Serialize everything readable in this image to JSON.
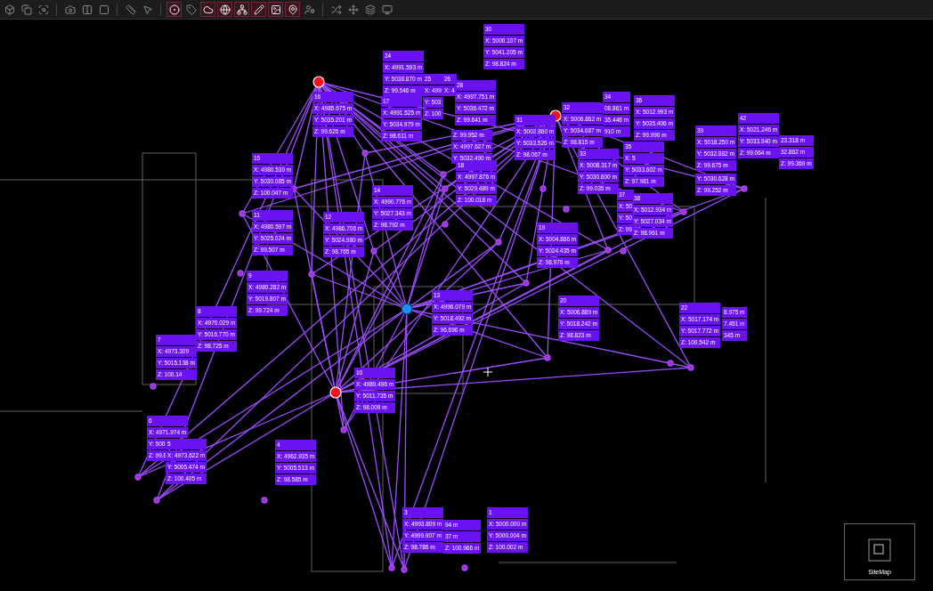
{
  "toolbar": {
    "groups": [
      [
        {
          "active": false
        },
        {
          "active": false
        },
        {
          "active": false
        }
      ],
      [
        {
          "active": false
        },
        {
          "active": false
        },
        {
          "active": false
        }
      ],
      [
        {
          "active": false
        },
        {
          "active": false
        }
      ],
      [
        {
          "active": true
        },
        {
          "active": false
        },
        {
          "active": true
        },
        {
          "active": true
        },
        {
          "active": true
        },
        {
          "active": true
        },
        {
          "active": true
        },
        {
          "active": true
        },
        {
          "active": false
        }
      ],
      [
        {
          "active": false
        },
        {
          "active": false
        },
        {
          "active": false
        },
        {
          "active": false
        }
      ]
    ]
  },
  "labels": [
    {
      "rows": [
        "30",
        "X: 5000.107 m",
        "Y: 5041.205 m",
        "Z: 98.824 m"
      ]
    },
    {
      "rows": [
        "24",
        "X: 4991.593 m",
        "Y: 5038.870 m",
        "Z: 99.546 m"
      ]
    },
    {
      "rows": [
        "25",
        "X: 499",
        "Y: 503",
        "Z: 100"
      ]
    },
    {
      "rows": [
        "26",
        "X: 4"
      ]
    },
    {
      "rows": [
        "28",
        "X: 4997.751 m",
        "Y: 5036.472 m",
        "Z: 99.641 m"
      ]
    },
    {
      "rows": [
        "16",
        "X: 4985.675 m",
        "Y: 5035.201 m",
        "Z: 99.626 m"
      ]
    },
    {
      "rows": [
        "17",
        "X: 4991.525 m",
        "Y: 5034.979 m",
        "Z: 98.611 m"
      ]
    },
    {
      "rows": [
        "Z: 99.952 m",
        "X: 4997.627 m",
        "Y: 5032.490 m"
      ]
    },
    {
      "rows": [
        "18",
        "X: 4997.876 m",
        "Y: 5029.489 m",
        "Z: 100.018 m"
      ]
    },
    {
      "rows": [
        "31",
        "X: 5002.860 m",
        "Y: 5033.526 m",
        "Z: 98.067 m"
      ]
    },
    {
      "rows": [
        "32",
        "X: 5006.862 m",
        "Y: 5034.687 m",
        "Z: 98.815 m"
      ]
    },
    {
      "rows": [
        "34",
        "08.861 m",
        "35.446 m",
        "910 m"
      ]
    },
    {
      "rows": [
        "36",
        "X: 5012.993 m",
        "Y: 5035.406 m",
        "Z: 99.990 m"
      ]
    },
    {
      "rows": [
        "35",
        "X: 5",
        "Y: 5033.602 m",
        "Z: 97.981 m"
      ]
    },
    {
      "rows": [
        "33",
        "X: 5008.317 m",
        "Y: 5030.800 m",
        "Z: 99.035 m"
      ]
    },
    {
      "rows": [
        "39",
        "X: 5018.250 m",
        "Y: 5032.882 m",
        "Z: 99.675 m"
      ]
    },
    {
      "rows": [
        "Y: 5030.628 m",
        "Z: 99.252 m"
      ]
    },
    {
      "rows": [
        "42",
        "X: 5021.246 m",
        "Y: 5033.940 m",
        "Z: 99.064 m"
      ]
    },
    {
      "rows": [
        "23.318 m",
        "32.862 m",
        "Z: 99.369 m"
      ]
    },
    {
      "rows": [
        "15",
        "X: 4980.539 m",
        "Y: 5030.085 m",
        "Z: 100.047 m"
      ]
    },
    {
      "rows": [
        "14",
        "X: 4990.776 m",
        "Y: 5027.343 m",
        "Z: 98.792 m"
      ]
    },
    {
      "rows": [
        "11",
        "X: 4980.597 m",
        "Y: 5025.024 m",
        "Z: 99.507 m"
      ]
    },
    {
      "rows": [
        "12",
        "X: 4986.706 m",
        "Y: 5024.980 m",
        "Z: 98.765 m"
      ]
    },
    {
      "rows": [
        "37",
        "X: 50",
        "Y: 50",
        "Z: 99"
      ]
    },
    {
      "rows": [
        "38",
        "X: 5012.934 m",
        "Y: 5027.034 m",
        "Z: 98.961 m"
      ]
    },
    {
      "rows": [
        "19",
        "X: 5004.886 m",
        "Y: 5024.435 m",
        "Z: 98.976 m"
      ]
    },
    {
      "rows": [
        "9",
        "X: 4980.282 m",
        "Y: 5019.807 m",
        "Z: 99.724 m"
      ]
    },
    {
      "rows": [
        "13",
        "X: 4996.079 m",
        "Y: 5018.492 m",
        "Z: 96.696 m"
      ]
    },
    {
      "rows": [
        "20",
        "X: 5006.889 m",
        "Y: 5018.242 m",
        "Z: 98.823 m"
      ]
    },
    {
      "rows": [
        "22",
        "X: 5017.174 m",
        "Y: 5017.772 m",
        "Z: 100.542 m"
      ]
    },
    {
      "rows": [
        "8.975 m",
        "7.451 m",
        "345 m"
      ]
    },
    {
      "rows": [
        "7",
        "X: 4973.309",
        "Y: 5015.138 m",
        "Z: 100.14"
      ]
    },
    {
      "rows": [
        "8",
        "X: 4976.029 m",
        "Y: 5016.770 m",
        "Z: 98.725 m"
      ]
    },
    {
      "rows": [
        "10",
        "X: 4989.496 m",
        "Y: 5011.735 m",
        "Z: 98.009 m"
      ]
    },
    {
      "rows": [
        "6",
        "X: 4971.974 m",
        "Y: 500",
        "Z: 99.8"
      ]
    },
    {
      "rows": [
        "5",
        "X: 4973.622 m",
        "Y: 5005.474 m",
        "Z: 100.405 m"
      ]
    },
    {
      "rows": [
        "4",
        "X: 4962.935 m",
        "Y: 5005.513 m",
        "Z: 98.585 m"
      ]
    },
    {
      "rows": [
        "3",
        "X: 4993.809 m",
        "Y: 4999.907 m",
        "Z: 98.786 m"
      ]
    },
    {
      "rows": [
        "94 m",
        "37 m",
        "Z: 100.966 m"
      ]
    },
    {
      "rows": [
        "1",
        "X: 5000.000 m",
        "Y: 5000.004 m",
        "Z: 100.002 m"
      ]
    }
  ],
  "minimap": {
    "title": "SiteMap"
  }
}
